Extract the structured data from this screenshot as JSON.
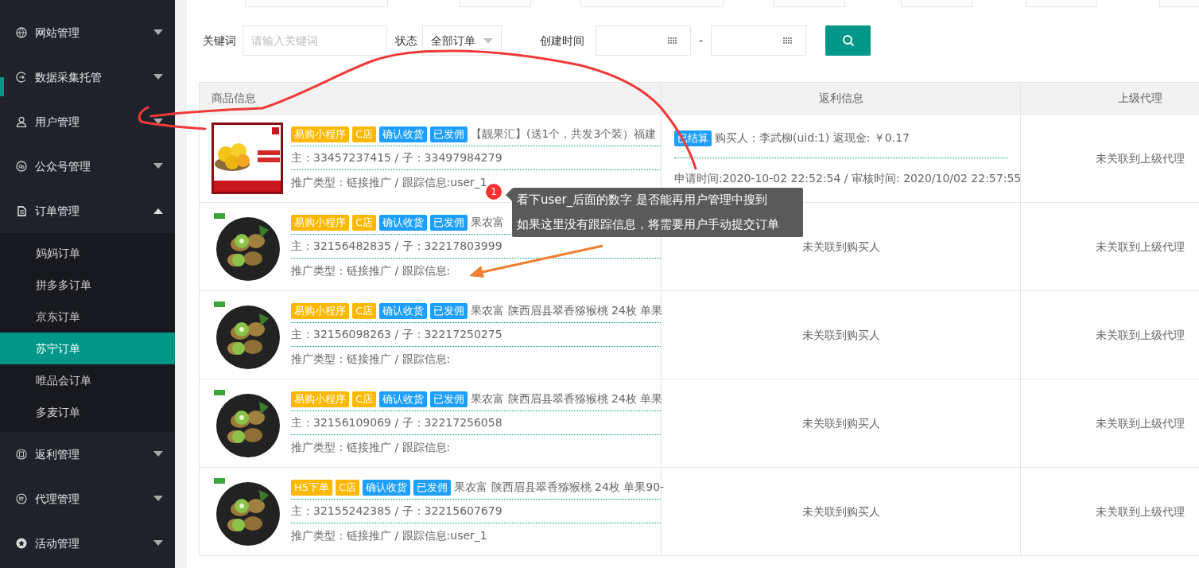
{
  "sidebar": {
    "items": [
      {
        "label": "网站管理",
        "expanded": false
      },
      {
        "label": "数据采集托管",
        "expanded": false
      },
      {
        "label": "用户管理",
        "expanded": false
      },
      {
        "label": "公众号管理",
        "expanded": false
      },
      {
        "label": "订单管理",
        "expanded": true,
        "children": [
          {
            "label": "妈妈订单",
            "selected": false
          },
          {
            "label": "拼多多订单",
            "selected": false
          },
          {
            "label": "京东订单",
            "selected": false
          },
          {
            "label": "苏宁订单",
            "selected": true
          },
          {
            "label": "唯品会订单",
            "selected": false
          },
          {
            "label": "多麦订单",
            "selected": false
          }
        ]
      },
      {
        "label": "返利管理",
        "expanded": false
      },
      {
        "label": "代理管理",
        "expanded": false
      },
      {
        "label": "活动管理",
        "expanded": false
      }
    ]
  },
  "filters": {
    "keyword": {
      "label": "关键词",
      "placeholder": "请输入关键词"
    },
    "status": {
      "label": "状态",
      "value": "全部订单"
    },
    "created": {
      "label": "创建时间",
      "separator": "-"
    }
  },
  "table": {
    "columns": [
      "商品信息",
      "返利信息",
      "上级代理"
    ],
    "rows": [
      {
        "tags": [
          {
            "text": "易购小程序",
            "color": "#ffb800"
          },
          {
            "text": "C店",
            "color": "#ffb800"
          },
          {
            "text": "确认收货",
            "color": "#1e9fff"
          },
          {
            "text": "已发佣",
            "color": "#1e9fff"
          }
        ],
        "title": "【靓果汇】(送1个，共发3个装）福建",
        "ids": "主：33457237415 / 子：33497984279",
        "tracking": "推广类型：链接推广 / 跟踪信息:user_1",
        "rebate": {
          "kind": "settled",
          "tag": "已结算",
          "buyer": "购买人：李武柳(uid:1) 返现金: ￥0.17",
          "times": "申请时间:2020-10-02 22:52:54 / 审核时间: 2020/10/02 22:57:55"
        },
        "agent": "未关联到上级代理"
      },
      {
        "tags": [
          {
            "text": "易购小程序",
            "color": "#ffb800"
          },
          {
            "text": "C店",
            "color": "#ffb800"
          },
          {
            "text": "确认收货",
            "color": "#1e9fff"
          },
          {
            "text": "已发佣",
            "color": "#1e9fff"
          }
        ],
        "title": "果农富",
        "ids": "主：32156482835 / 子：32217803999",
        "tracking": "推广类型：链接推广 / 跟踪信息:",
        "rebate": {
          "kind": "none",
          "text": "未关联到购买人"
        },
        "agent": "未关联到上级代理"
      },
      {
        "tags": [
          {
            "text": "易购小程序",
            "color": "#ffb800"
          },
          {
            "text": "C店",
            "color": "#ffb800"
          },
          {
            "text": "确认收货",
            "color": "#1e9fff"
          },
          {
            "text": "已发佣",
            "color": "#1e9fff"
          }
        ],
        "title": "果农富 陕西眉县翠香猕猴桃 24枚 单果",
        "ids": "主：32156098263 / 子：32217250275",
        "tracking": "推广类型：链接推广 / 跟踪信息:",
        "rebate": {
          "kind": "none",
          "text": "未关联到购买人"
        },
        "agent": "未关联到上级代理"
      },
      {
        "tags": [
          {
            "text": "易购小程序",
            "color": "#ffb800"
          },
          {
            "text": "C店",
            "color": "#ffb800"
          },
          {
            "text": "确认收货",
            "color": "#1e9fff"
          },
          {
            "text": "已发佣",
            "color": "#1e9fff"
          }
        ],
        "title": "果农富 陕西眉县翠香猕猴桃 24枚 单果",
        "ids": "主：32156109069 / 子：32217256058",
        "tracking": "推广类型：链接推广 / 跟踪信息:",
        "rebate": {
          "kind": "none",
          "text": "未关联到购买人"
        },
        "agent": "未关联到上级代理"
      },
      {
        "tags": [
          {
            "text": "H5下单",
            "color": "#ffb800"
          },
          {
            "text": "C店",
            "color": "#ffb800"
          },
          {
            "text": "确认收货",
            "color": "#1e9fff"
          },
          {
            "text": "已发佣",
            "color": "#1e9fff"
          }
        ],
        "title": "果农富 陕西眉县翠香猕猴桃 24枚 单果90-",
        "ids": "主：32155242385 / 子：32215607679",
        "tracking": "推广类型：链接推广 / 跟踪信息:user_1",
        "rebate": {
          "kind": "none",
          "text": "未关联到购买人"
        },
        "agent": "未关联到上级代理"
      }
    ]
  },
  "annotation": {
    "badge": "1",
    "lines": [
      "看下user_后面的数字 是否能再用户管理中搜到",
      "如果这里没有跟踪信息，将需要用户手动提交订单"
    ]
  }
}
